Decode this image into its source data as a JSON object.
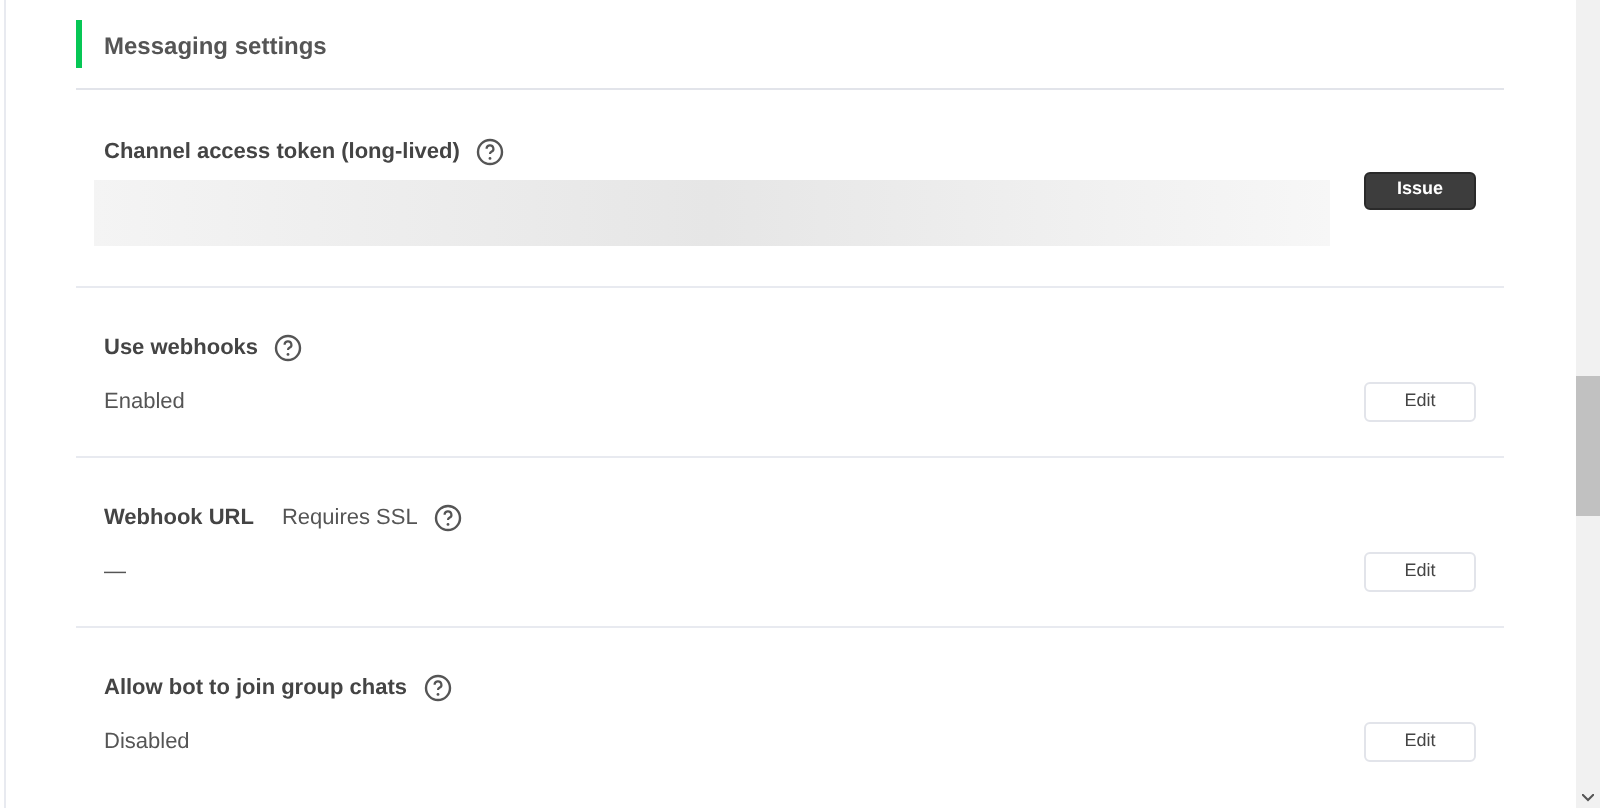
{
  "section": {
    "title": "Messaging settings"
  },
  "rows": [
    {
      "kind": "token",
      "label": "Channel access token (long-lived)",
      "help": true,
      "button": "Issue"
    },
    {
      "kind": "value",
      "label": "Use webhooks",
      "help": true,
      "value": "Enabled",
      "button": "Edit"
    },
    {
      "kind": "value",
      "label": "Webhook URL",
      "note": "Requires SSL",
      "help": true,
      "value": "—",
      "button": "Edit"
    },
    {
      "kind": "value",
      "label": "Allow bot to join group chats",
      "help": true,
      "value": "Disabled",
      "button": "Edit"
    }
  ]
}
